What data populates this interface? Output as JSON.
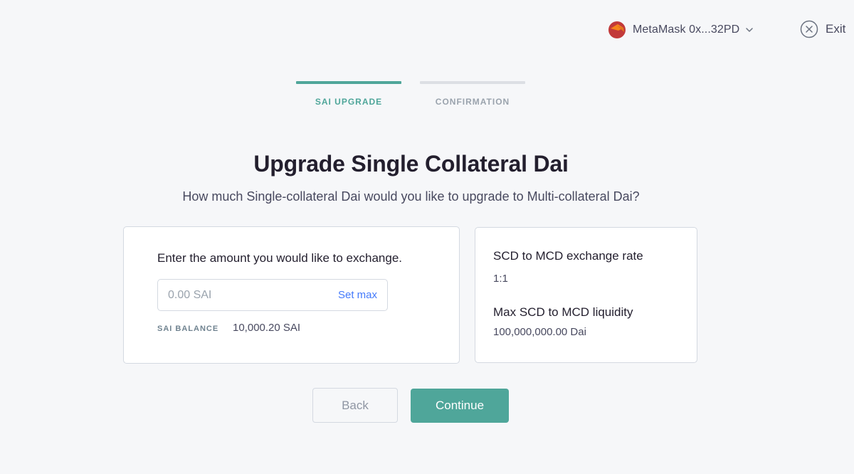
{
  "header": {
    "account_label": "MetaMask 0x...32PD",
    "wallet_icon": "metamask-fox-icon",
    "dropdown_icon": "chevron-down-icon",
    "exit_label": "Exit",
    "exit_icon": "close-circle-icon"
  },
  "stepper": {
    "steps": [
      {
        "label": "SAI UPGRADE",
        "active": true
      },
      {
        "label": "CONFIRMATION",
        "active": false
      }
    ]
  },
  "main": {
    "title": "Upgrade Single Collateral Dai",
    "subtitle": "How much Single-collateral Dai would you like to upgrade to Multi-collateral Dai?"
  },
  "exchange_card": {
    "prompt": "Enter the amount you would like to exchange.",
    "amount_value": "",
    "amount_placeholder": "0.00 SAI",
    "set_max_label": "Set max",
    "balance_label": "SAI BALANCE",
    "balance_value": "10,000.20 SAI"
  },
  "info_card": {
    "rate_label": "SCD to MCD exchange rate",
    "rate_value": "1:1",
    "liquidity_label": "Max SCD to MCD liquidity",
    "liquidity_value": "100,000,000.00 Dai"
  },
  "actions": {
    "back_label": "Back",
    "continue_label": "Continue"
  },
  "colors": {
    "accent": "#4fa69a",
    "link": "#447afb",
    "background": "#f6f7f9",
    "inactive_step": "#dcdfe4"
  }
}
